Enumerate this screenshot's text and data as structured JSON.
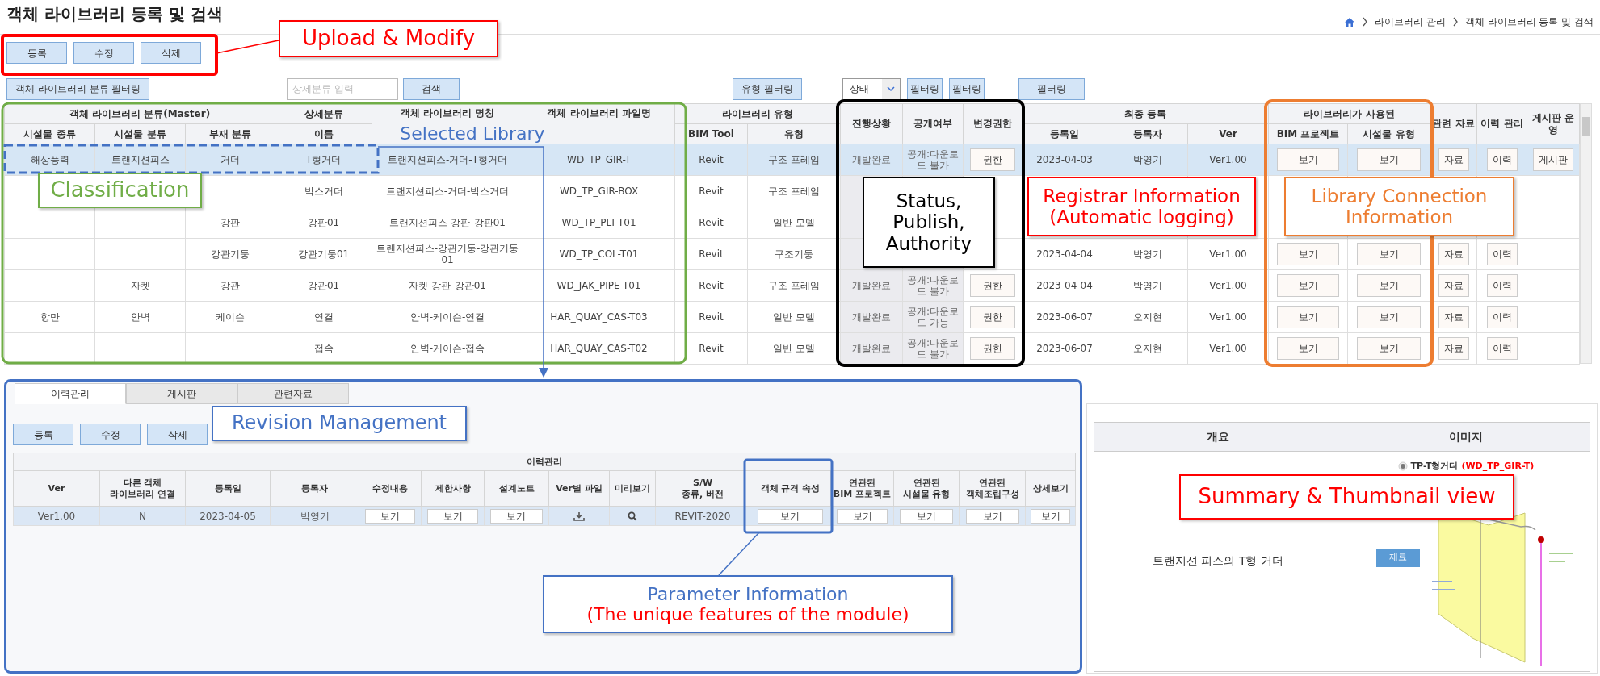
{
  "page": {
    "title": "객체 라이브러리 등록 및 검색",
    "breadcrumb": [
      "라이브러리 관리",
      "객체 라이브러리 등록 및 검색"
    ]
  },
  "actions": [
    "등록",
    "수정",
    "삭제"
  ],
  "filters": {
    "class_filter": "객체 라이브러리 분류 필터링",
    "detail_placeholder": "상세분류 입력",
    "search": "검색",
    "type_filter": "유형 필터링",
    "status_select": "상태",
    "filter_buttons": [
      "필터링",
      "필터링",
      "필터링"
    ]
  },
  "library_table": {
    "header": [
      {
        "label": "객체 라이브러리 분류(Master)",
        "sub": [
          "시설물 종류",
          "시설물 분류",
          "부재 분류"
        ]
      },
      {
        "label": "상세분류",
        "sub": [
          "이름"
        ]
      },
      {
        "label": "객체 라이브러리 명칭"
      },
      {
        "label": "객체 라이브러리 파일명"
      },
      {
        "label": "라이브러리 유형",
        "sub": [
          "BIM Tool",
          "유형"
        ]
      },
      {
        "label": "진행상황"
      },
      {
        "label": "공개여부"
      },
      {
        "label": "변경권한"
      },
      {
        "label": "최종 등록",
        "sub": [
          "등록일",
          "등록자",
          "Ver"
        ]
      },
      {
        "label": "라이브러리가 사용된",
        "sub": [
          "BIM 프로젝트",
          "시설물 유형"
        ]
      },
      {
        "label": "관련 자료"
      },
      {
        "label": "이력 관리"
      },
      {
        "label": "게시판 운영"
      }
    ],
    "rows": [
      {
        "selected": true,
        "cells": [
          {
            "kind": "text",
            "text": "해상풍력"
          },
          {
            "kind": "text",
            "text": "트랜지션피스"
          },
          {
            "kind": "text",
            "text": "거더"
          },
          {
            "kind": "text",
            "text": "T형거더"
          },
          {
            "kind": "text",
            "text": "트랜지션피스-거더-T형거더"
          },
          {
            "kind": "text",
            "text": "WD_TP_GIR-T"
          },
          {
            "kind": "text",
            "text": "Revit"
          },
          {
            "kind": "text",
            "text": "구조 프레임"
          },
          {
            "kind": "text",
            "text": "개발완료"
          },
          {
            "kind": "text",
            "text": "공개:다운로드 불가"
          },
          {
            "kind": "button",
            "text": "권한"
          },
          {
            "kind": "text",
            "text": "2023-04-03"
          },
          {
            "kind": "text",
            "text": "박영기"
          },
          {
            "kind": "text",
            "text": "Ver1.00"
          },
          {
            "kind": "button",
            "text": "보기"
          },
          {
            "kind": "button",
            "text": "보기"
          },
          {
            "kind": "button",
            "text": "자료"
          },
          {
            "kind": "button",
            "text": "이력"
          },
          {
            "kind": "button",
            "text": "게시판"
          }
        ]
      },
      {
        "selected": false,
        "cells": [
          {
            "kind": "empty"
          },
          {
            "kind": "empty"
          },
          {
            "kind": "empty"
          },
          {
            "kind": "text",
            "text": "박스거더"
          },
          {
            "kind": "text",
            "text": "트랜지션피스-거더-박스거더"
          },
          {
            "kind": "text",
            "text": "WD_TP_GIR-BOX"
          },
          {
            "kind": "text",
            "text": "Revit"
          },
          {
            "kind": "text",
            "text": "구조 프레임"
          },
          {
            "kind": "empty"
          },
          {
            "kind": "empty"
          },
          {
            "kind": "empty"
          },
          {
            "kind": "empty"
          },
          {
            "kind": "empty"
          },
          {
            "kind": "empty"
          },
          {
            "kind": "empty"
          },
          {
            "kind": "empty"
          },
          {
            "kind": "empty"
          },
          {
            "kind": "empty"
          },
          {
            "kind": "empty"
          }
        ]
      },
      {
        "selected": false,
        "cells": [
          {
            "kind": "empty"
          },
          {
            "kind": "empty"
          },
          {
            "kind": "text",
            "text": "강판"
          },
          {
            "kind": "text",
            "text": "강판01"
          },
          {
            "kind": "text",
            "text": "트랜지션피스-강판-강판01"
          },
          {
            "kind": "text",
            "text": "WD_TP_PLT-T01"
          },
          {
            "kind": "text",
            "text": "Revit"
          },
          {
            "kind": "text",
            "text": "일반 모델"
          },
          {
            "kind": "empty"
          },
          {
            "kind": "empty"
          },
          {
            "kind": "empty"
          },
          {
            "kind": "empty"
          },
          {
            "kind": "empty"
          },
          {
            "kind": "empty"
          },
          {
            "kind": "empty"
          },
          {
            "kind": "empty"
          },
          {
            "kind": "empty"
          },
          {
            "kind": "empty"
          },
          {
            "kind": "empty"
          }
        ]
      },
      {
        "selected": false,
        "cells": [
          {
            "kind": "empty"
          },
          {
            "kind": "empty"
          },
          {
            "kind": "text",
            "text": "강관기둥"
          },
          {
            "kind": "text",
            "text": "강관기둥01"
          },
          {
            "kind": "text",
            "text": "트랜지션피스-강관기둥-강관기둥01"
          },
          {
            "kind": "text",
            "text": "WD_TP_COL-T01"
          },
          {
            "kind": "text",
            "text": "Revit"
          },
          {
            "kind": "text",
            "text": "구조기둥"
          },
          {
            "kind": "empty"
          },
          {
            "kind": "empty"
          },
          {
            "kind": "empty"
          },
          {
            "kind": "text",
            "text": "2023-04-04"
          },
          {
            "kind": "text",
            "text": "박영기"
          },
          {
            "kind": "text",
            "text": "Ver1.00"
          },
          {
            "kind": "button",
            "text": "보기"
          },
          {
            "kind": "button",
            "text": "보기"
          },
          {
            "kind": "button",
            "text": "자료"
          },
          {
            "kind": "button",
            "text": "이력"
          },
          {
            "kind": "empty"
          }
        ]
      },
      {
        "selected": false,
        "cells": [
          {
            "kind": "empty"
          },
          {
            "kind": "text",
            "text": "자켓"
          },
          {
            "kind": "text",
            "text": "강관"
          },
          {
            "kind": "text",
            "text": "강관01"
          },
          {
            "kind": "text",
            "text": "자켓-강관-강관01"
          },
          {
            "kind": "text",
            "text": "WD_JAK_PIPE-T01"
          },
          {
            "kind": "text",
            "text": "Revit"
          },
          {
            "kind": "text",
            "text": "구조 프레임"
          },
          {
            "kind": "text",
            "text": "개발완료"
          },
          {
            "kind": "text",
            "text": "공개:다운로드 불가"
          },
          {
            "kind": "button",
            "text": "권한"
          },
          {
            "kind": "text",
            "text": "2023-04-04"
          },
          {
            "kind": "text",
            "text": "박영기"
          },
          {
            "kind": "text",
            "text": "Ver1.00"
          },
          {
            "kind": "button",
            "text": "보기"
          },
          {
            "kind": "button",
            "text": "보기"
          },
          {
            "kind": "button",
            "text": "자료"
          },
          {
            "kind": "button",
            "text": "이력"
          },
          {
            "kind": "empty"
          }
        ]
      },
      {
        "selected": false,
        "cells": [
          {
            "kind": "text",
            "text": "항만"
          },
          {
            "kind": "text",
            "text": "안벽"
          },
          {
            "kind": "text",
            "text": "케이슨"
          },
          {
            "kind": "text",
            "text": "연결"
          },
          {
            "kind": "text",
            "text": "안벽-케이슨-연결"
          },
          {
            "kind": "text",
            "text": "HAR_QUAY_CAS-T03"
          },
          {
            "kind": "text",
            "text": "Revit"
          },
          {
            "kind": "text",
            "text": "일반 모델"
          },
          {
            "kind": "text",
            "text": "개발완료"
          },
          {
            "kind": "text",
            "text": "공개:다운로드 가능"
          },
          {
            "kind": "button",
            "text": "권한"
          },
          {
            "kind": "text",
            "text": "2023-06-07"
          },
          {
            "kind": "text",
            "text": "오지현"
          },
          {
            "kind": "text",
            "text": "Ver1.00"
          },
          {
            "kind": "button",
            "text": "보기"
          },
          {
            "kind": "button",
            "text": "보기"
          },
          {
            "kind": "button",
            "text": "자료"
          },
          {
            "kind": "button",
            "text": "이력"
          },
          {
            "kind": "empty"
          }
        ]
      },
      {
        "selected": false,
        "cells": [
          {
            "kind": "empty"
          },
          {
            "kind": "empty"
          },
          {
            "kind": "empty"
          },
          {
            "kind": "text",
            "text": "접속"
          },
          {
            "kind": "text",
            "text": "안벽-케이슨-접속"
          },
          {
            "kind": "text",
            "text": "HAR_QUAY_CAS-T02"
          },
          {
            "kind": "text",
            "text": "Revit"
          },
          {
            "kind": "text",
            "text": "일반 모델"
          },
          {
            "kind": "text",
            "text": "개발완료"
          },
          {
            "kind": "text",
            "text": "공개:다운로드 불가"
          },
          {
            "kind": "button",
            "text": "권한"
          },
          {
            "kind": "text",
            "text": "2023-06-07"
          },
          {
            "kind": "text",
            "text": "오지현"
          },
          {
            "kind": "text",
            "text": "Ver1.00"
          },
          {
            "kind": "button",
            "text": "보기"
          },
          {
            "kind": "button",
            "text": "보기"
          },
          {
            "kind": "button",
            "text": "자료"
          },
          {
            "kind": "button",
            "text": "이력"
          },
          {
            "kind": "empty"
          }
        ]
      }
    ]
  },
  "detail_panel": {
    "tabs": [
      {
        "label": "이력관리",
        "selected": true
      },
      {
        "label": "게시판",
        "selected": false
      },
      {
        "label": "관련자료",
        "selected": false
      }
    ],
    "actions": [
      "등록",
      "수정",
      "삭제"
    ],
    "history_table": {
      "title": "이력관리",
      "columns": [
        "Ver",
        "다른 객체\n라이브러리 연결",
        "등록일",
        "등록자",
        "수정내용",
        "제한사항",
        "설계노트",
        "Ver별 파일",
        "미리보기",
        "S/W\n종류, 버전",
        "객체 규격 속성",
        "연관된\nBIM 프로젝트",
        "연관된\n시설물 유형",
        "연관된\n객체조립구성",
        "상세보기"
      ],
      "rows": [
        {
          "selected": true,
          "cells": [
            {
              "kind": "text",
              "text": "Ver1.00"
            },
            {
              "kind": "text",
              "text": "N"
            },
            {
              "kind": "text",
              "text": "2023-04-05"
            },
            {
              "kind": "text",
              "text": "박영기"
            },
            {
              "kind": "button",
              "text": "보기"
            },
            {
              "kind": "button",
              "text": "보기"
            },
            {
              "kind": "button",
              "text": "보기"
            },
            {
              "kind": "download"
            },
            {
              "kind": "search"
            },
            {
              "kind": "text",
              "text": "REVIT-2020"
            },
            {
              "kind": "button",
              "text": "보기"
            },
            {
              "kind": "button",
              "text": "보기"
            },
            {
              "kind": "button",
              "text": "보기"
            },
            {
              "kind": "button",
              "text": "보기"
            },
            {
              "kind": "button",
              "text": "보기"
            }
          ]
        }
      ]
    }
  },
  "summary": {
    "headers": [
      "개요",
      "이미지"
    ],
    "description": "트랜지션 피스의 T형 거더",
    "image_title": "TP-T형거더",
    "image_code": "(WD_TP_GIR-T)",
    "material_label": "재료"
  },
  "callouts": [
    {
      "lines": [
        {
          "text": "Upload & Modify",
          "color": "#ff0000"
        }
      ]
    },
    {
      "lines": [
        {
          "text": "Selected Library",
          "color": "#4472c4"
        }
      ]
    },
    {
      "lines": [
        {
          "text": "Classification",
          "color": "#70ad47"
        }
      ]
    },
    {
      "lines": [
        {
          "text": "Status, Publish, Authority",
          "color": "#000000"
        }
      ]
    },
    {
      "lines": [
        {
          "text": "Registrar Information",
          "color": "#ff0000"
        },
        {
          "text": "(Automatic logging)",
          "color": "#ff0000"
        }
      ]
    },
    {
      "lines": [
        {
          "text": "Library Connection",
          "color": "#ed7d31"
        },
        {
          "text": "Information",
          "color": "#ed7d31"
        }
      ]
    },
    {
      "lines": [
        {
          "text": "Revision Management",
          "color": "#4472c4"
        }
      ]
    },
    {
      "lines": [
        {
          "text": "Parameter Information",
          "color": "#4472c4"
        },
        {
          "text": "(The unique features of the module)",
          "color": "#ff0000"
        }
      ]
    },
    {
      "lines": [
        {
          "text": "Summary & Thumbnail view",
          "color": "#ff0000"
        }
      ]
    }
  ]
}
